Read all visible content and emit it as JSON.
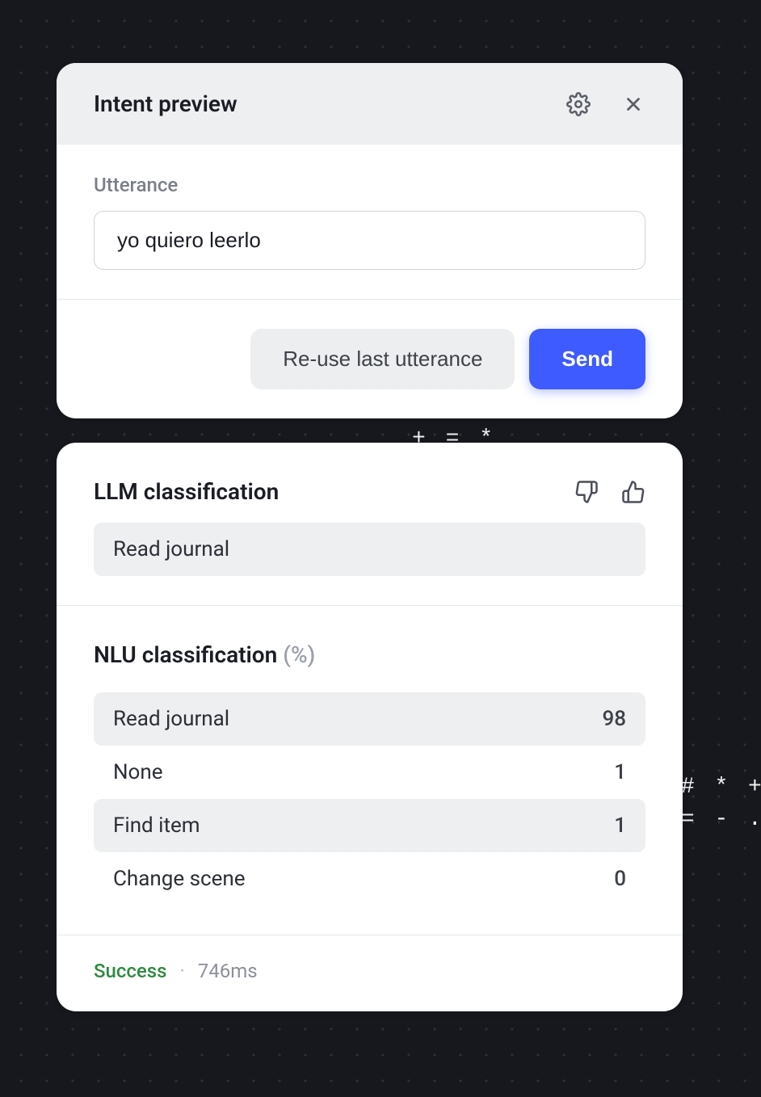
{
  "header": {
    "title": "Intent preview"
  },
  "form": {
    "utterance_label": "Utterance",
    "utterance_value": "yo quiero leerlo",
    "reuse_label": "Re-use last utterance",
    "send_label": "Send"
  },
  "llm": {
    "title": "LLM classification",
    "result": "Read journal"
  },
  "nlu": {
    "title": "NLU classification",
    "suffix": "(%)",
    "rows": [
      {
        "label": "Read journal",
        "value": "98"
      },
      {
        "label": "None",
        "value": "1"
      },
      {
        "label": "Find item",
        "value": "1"
      },
      {
        "label": "Change scene",
        "value": "0"
      }
    ]
  },
  "footer": {
    "status": "Success",
    "separator": "·",
    "time": "746ms"
  },
  "background_text": "- + *\n@ @ (\n@ @ (\n@ @ (\n% % #\n* * -\n+ = *\n+ = *\n* * #\n% % %\n% % %\n% # #\n# # #\n# * *\n+ + *\n= - \n- . \n . : \n- @ @ @ % % # # # * + = - .     + + -\n@ @ % # # # * + = - ."
}
